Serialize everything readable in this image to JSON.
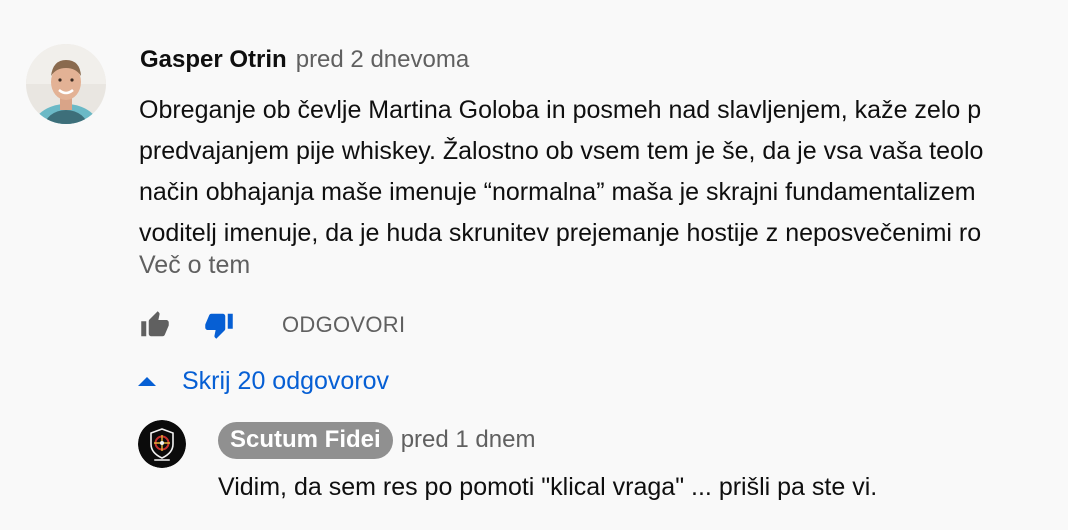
{
  "comment": {
    "author": "Gasper Otrin",
    "timestamp": "pred 2 dnevoma",
    "lines": [
      "Obreganje ob čevlje Martina Goloba in posmeh nad slavljenjem, kaže zelo p",
      "predvajanjem pije whiskey. Žalostno ob vsem tem je še, da je vsa vaša teolo",
      "način obhajanja maše imenuje “normalna” maša je skrajni fundamentalizem",
      "voditelj imenuje, da je huda skrunitev prejemanje hostije z neposvečenimi ro"
    ],
    "read_more": "Več o tem",
    "reply_label": "ODGOVORI",
    "like_icon": "thumb-up-icon",
    "dislike_icon": "thumb-down-icon",
    "dislike_active_color": "#065fd4"
  },
  "replies_toggle": {
    "label": "Skrij 20 odgovorov",
    "icon": "caret-up-icon",
    "color": "#065fd4"
  },
  "reply": {
    "author": "Scutum Fidei",
    "timestamp": "pred 1 dnem",
    "text": "Vidim, da sem res po pomoti \"klical vraga\" ... prišli pa ste vi."
  }
}
